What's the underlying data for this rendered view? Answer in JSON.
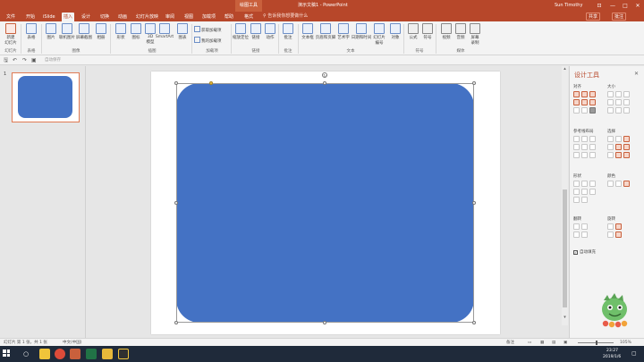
{
  "titlebar": {
    "context_tool": "绘图工具",
    "document": "演示文稿1  -  PowerPoint",
    "user": "Sun Timothy",
    "minimize": "—",
    "restore": "□",
    "close": "✕",
    "ribbon_display": "⊡"
  },
  "tabs": [
    {
      "label": "文件"
    },
    {
      "label": "开始"
    },
    {
      "label": "iSlide"
    },
    {
      "label": "插入"
    },
    {
      "label": "设计"
    },
    {
      "label": "切换"
    },
    {
      "label": "动画"
    },
    {
      "label": "幻灯片放映"
    },
    {
      "label": "审阅"
    },
    {
      "label": "视图"
    },
    {
      "label": "加载项"
    },
    {
      "label": "帮助"
    },
    {
      "label": "格式"
    }
  ],
  "active_tab": "插入",
  "tell_me": "告诉我你想要做什么",
  "share": "共享",
  "comments": "批注",
  "ribbon": {
    "new_slide": "新建\n幻灯片",
    "table": "表格",
    "picture": "图片",
    "online_picture": "联机图片",
    "screenshot": "屏幕截图",
    "album": "相册",
    "shapes": "形状",
    "icons": "图标",
    "model3d": "3D\n模型",
    "smartart": "SmartArt",
    "chart": "图表",
    "get_addins": "获取加载项",
    "my_addins": "我的加载项",
    "zoom": "缩放定位",
    "link": "链接",
    "action": "动作",
    "comment": "批注",
    "textbox": "文本框",
    "header_footer": "页眉和页脚",
    "wordart": "艺术字",
    "date_time": "日期和时间",
    "slide_number": "幻灯片\n编号",
    "object": "对象",
    "equation": "公式",
    "symbol": "符号",
    "video": "视频",
    "audio": "音频",
    "screen_record": "屏幕\n录制",
    "groups": {
      "slides": "幻灯片",
      "tables": "表格",
      "images": "图像",
      "illustrations": "插图",
      "addins": "加载项",
      "links": "链接",
      "comments": "批注",
      "text": "文本",
      "symbols": "符号",
      "media": "媒体"
    }
  },
  "qat": {
    "save": "🖫",
    "undo": "↶",
    "redo": "↷",
    "start": "▣",
    "touch_hint": "自动保存"
  },
  "thumbnails": [
    {
      "number": "1"
    }
  ],
  "pane": {
    "title": "设计工具",
    "close": "✕",
    "sections": {
      "align": "对齐",
      "size": "大小",
      "guides": "参考线布局",
      "select": "选择",
      "shape": "形状",
      "gradient": "颜色",
      "rotate": "旋转",
      "flip": "翻转"
    },
    "auto_fit": "自动填充"
  },
  "status": {
    "slide_info": "幻灯片 第 1 张，共 1 张",
    "language": "中文(中国)",
    "notes": "备注",
    "zoom": "105%"
  },
  "taskbar": {
    "time": "23:27",
    "date": "2019/1/6"
  },
  "colors": {
    "accent": "#b7472a",
    "shape_fill": "#4472c4"
  }
}
